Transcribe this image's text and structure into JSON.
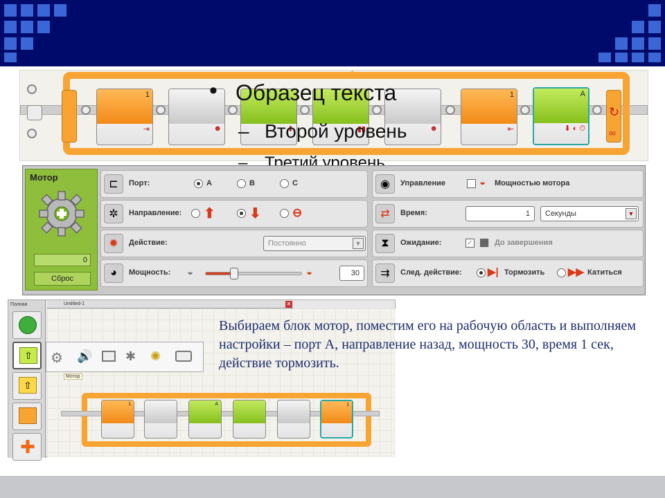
{
  "placeholder": {
    "bullet_char": "•",
    "level1": "Образец текста",
    "level2_bullet": "–",
    "level2": "Второй уровень",
    "level3_bullet": "–",
    "level3": "Третий уровень"
  },
  "program": {
    "block_numbers": [
      "1",
      "",
      "",
      "",
      "",
      "1",
      "A"
    ]
  },
  "motor_panel": {
    "title": "Мотор",
    "value": "0",
    "reset_label": "Сброс",
    "port": {
      "label": "Порт:",
      "options": [
        "A",
        "B",
        "C"
      ],
      "selected": "A"
    },
    "direction": {
      "label": "Направление:"
    },
    "action": {
      "label": "Действие:",
      "value": "Постоянно"
    },
    "power": {
      "label": "Мощность:",
      "value": "30",
      "level_percent": 30
    },
    "control": {
      "label": "Управление",
      "option": "Мощностью мотора"
    },
    "duration": {
      "label": "Время:",
      "value": "1",
      "unit": "Секунды"
    },
    "wait": {
      "label": "Ожидание:",
      "option": "До завершения"
    },
    "next_action": {
      "label": "След. действие:",
      "brake": "Тормозить",
      "coast": "Катиться"
    }
  },
  "ide": {
    "palette_label": "Полная",
    "tab_label": "Untitled-1",
    "close_glyph": "✕",
    "tooltip": "Мотор",
    "block_numbers": [
      "1",
      "",
      "A",
      "",
      "",
      "1"
    ]
  },
  "caption": {
    "text": "Выбираем блок мотор, поместим его на рабочую область и выполняем  настройки – порт А, направление назад, мощность 30, время 1 сек, действие тормозить."
  },
  "colors": {
    "header": "#000a6b",
    "header_squares": "#3b67d6",
    "loop": "#f7a432",
    "motor_green": "#8fbe3d",
    "caption": "#1f2d6e"
  }
}
